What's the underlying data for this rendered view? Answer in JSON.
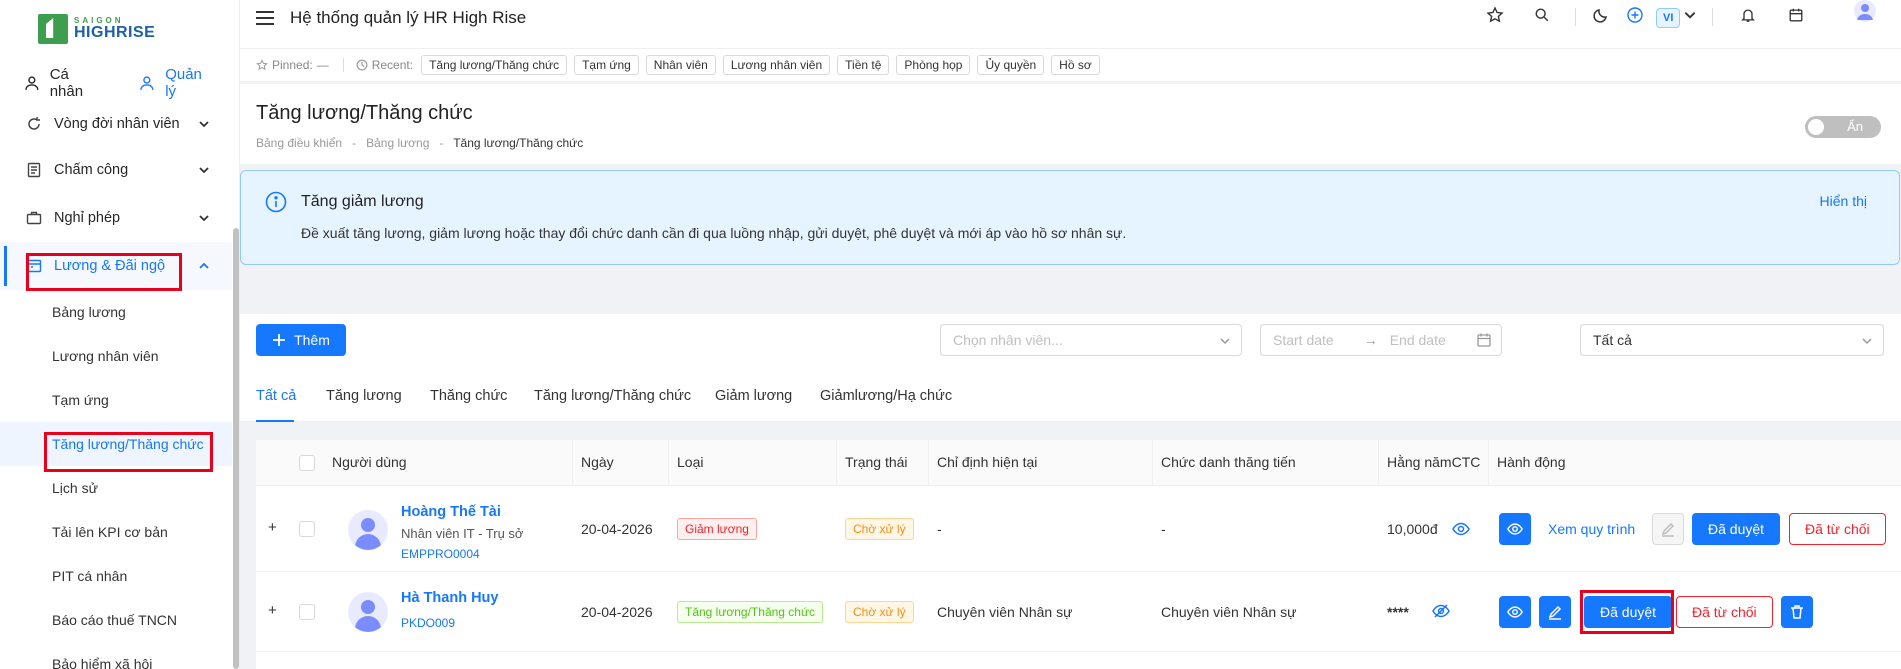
{
  "brand": {
    "line1": "SAIGON",
    "line2": "HIGHRISE"
  },
  "sidebar": {
    "roles": [
      {
        "label": "Cá nhân",
        "active": false
      },
      {
        "label": "Quản lý",
        "active": true
      }
    ],
    "groups": [
      {
        "label": "Vòng đời nhân viên",
        "icon": "lifecycle-icon"
      },
      {
        "label": "Chấm công",
        "icon": "timesheet-icon"
      },
      {
        "label": "Nghỉ phép",
        "icon": "leave-icon"
      },
      {
        "label": "Lương & Đãi ngộ",
        "icon": "salary-icon"
      }
    ],
    "sub_items": [
      "Bảng lương",
      "Lương nhân viên",
      "Tạm ứng",
      "Tăng lương/Thăng chức",
      "Lịch sử",
      "Tải lên KPI cơ bản",
      "PIT cá nhân",
      "Báo cáo thuế TNCN",
      "Bảo hiểm xã hội"
    ]
  },
  "header": {
    "title": "Hệ thống quản lý HR High Rise",
    "lang": "VI"
  },
  "recent_bar": {
    "pinned_label": "Pinned:",
    "pinned_value": "—",
    "recent_label": "Recent:",
    "chips": [
      "Tăng lương/Thăng chức",
      "Tạm ứng",
      "Nhân viên",
      "Lương nhân viên",
      "Tiền tệ",
      "Phòng họp",
      "Ủy quyền",
      "Hồ sơ"
    ]
  },
  "page": {
    "title": "Tăng lương/Thăng chức",
    "breadcrumb": [
      "Bảng điều khiển",
      "Bảng lương",
      "Tăng lương/Thăng chức"
    ],
    "toggle_label": "Ẩn"
  },
  "alert": {
    "title": "Tăng giảm lương",
    "desc": "Đề xuất tăng lương, giảm lương hoặc thay đổi chức danh cần đi qua luồng nhập, gửi duyệt, phê duyệt và mới áp vào hồ sơ nhân sự.",
    "link": "Hiển thị"
  },
  "toolbar": {
    "add_label": "Thêm",
    "employee_placeholder": "Chọn nhân viên...",
    "start_placeholder": "Start date",
    "end_placeholder": "End date",
    "status_value": "Tất cả"
  },
  "tabs": [
    "Tất cả",
    "Tăng lương",
    "Thăng chức",
    "Tăng lương/Thăng chức",
    "Giảm lương",
    "Giảmlương/Hạ chức"
  ],
  "table": {
    "columns": [
      "Người dùng",
      "Ngày",
      "Loại",
      "Trạng thái",
      "Chỉ định hiện tại",
      "Chức danh thăng tiến",
      "Hằng nămCTC",
      "Hành động"
    ],
    "rows": [
      {
        "name": "Hoàng Thế Tài",
        "position": "Nhân viên IT - Trụ sở",
        "code": "EMPPRO0004",
        "date": "20-04-2026",
        "type": "Giảm lương",
        "status": "Chờ xử lý",
        "current": "-",
        "promoted": "-",
        "ctc": "10,000đ",
        "action_view_flow": "Xem quy trình",
        "action_approve": "Đã duyệt",
        "action_reject": "Đã từ chối"
      },
      {
        "name": "Hà Thanh Huy",
        "position": "",
        "code": "PKDO009",
        "date": "20-04-2026",
        "type": "Tăng lương/Thăng chức",
        "status": "Chờ xử lý",
        "current": "Chuyên viên Nhân sự",
        "promoted": "Chuyên viên Nhân sự",
        "ctc": "****",
        "action_approve": "Đã duyệt",
        "action_reject": "Đã từ chối"
      }
    ]
  },
  "colors": {
    "primary": "#1677ff",
    "danger": "#f5222d",
    "highlight": "#e8001c"
  }
}
